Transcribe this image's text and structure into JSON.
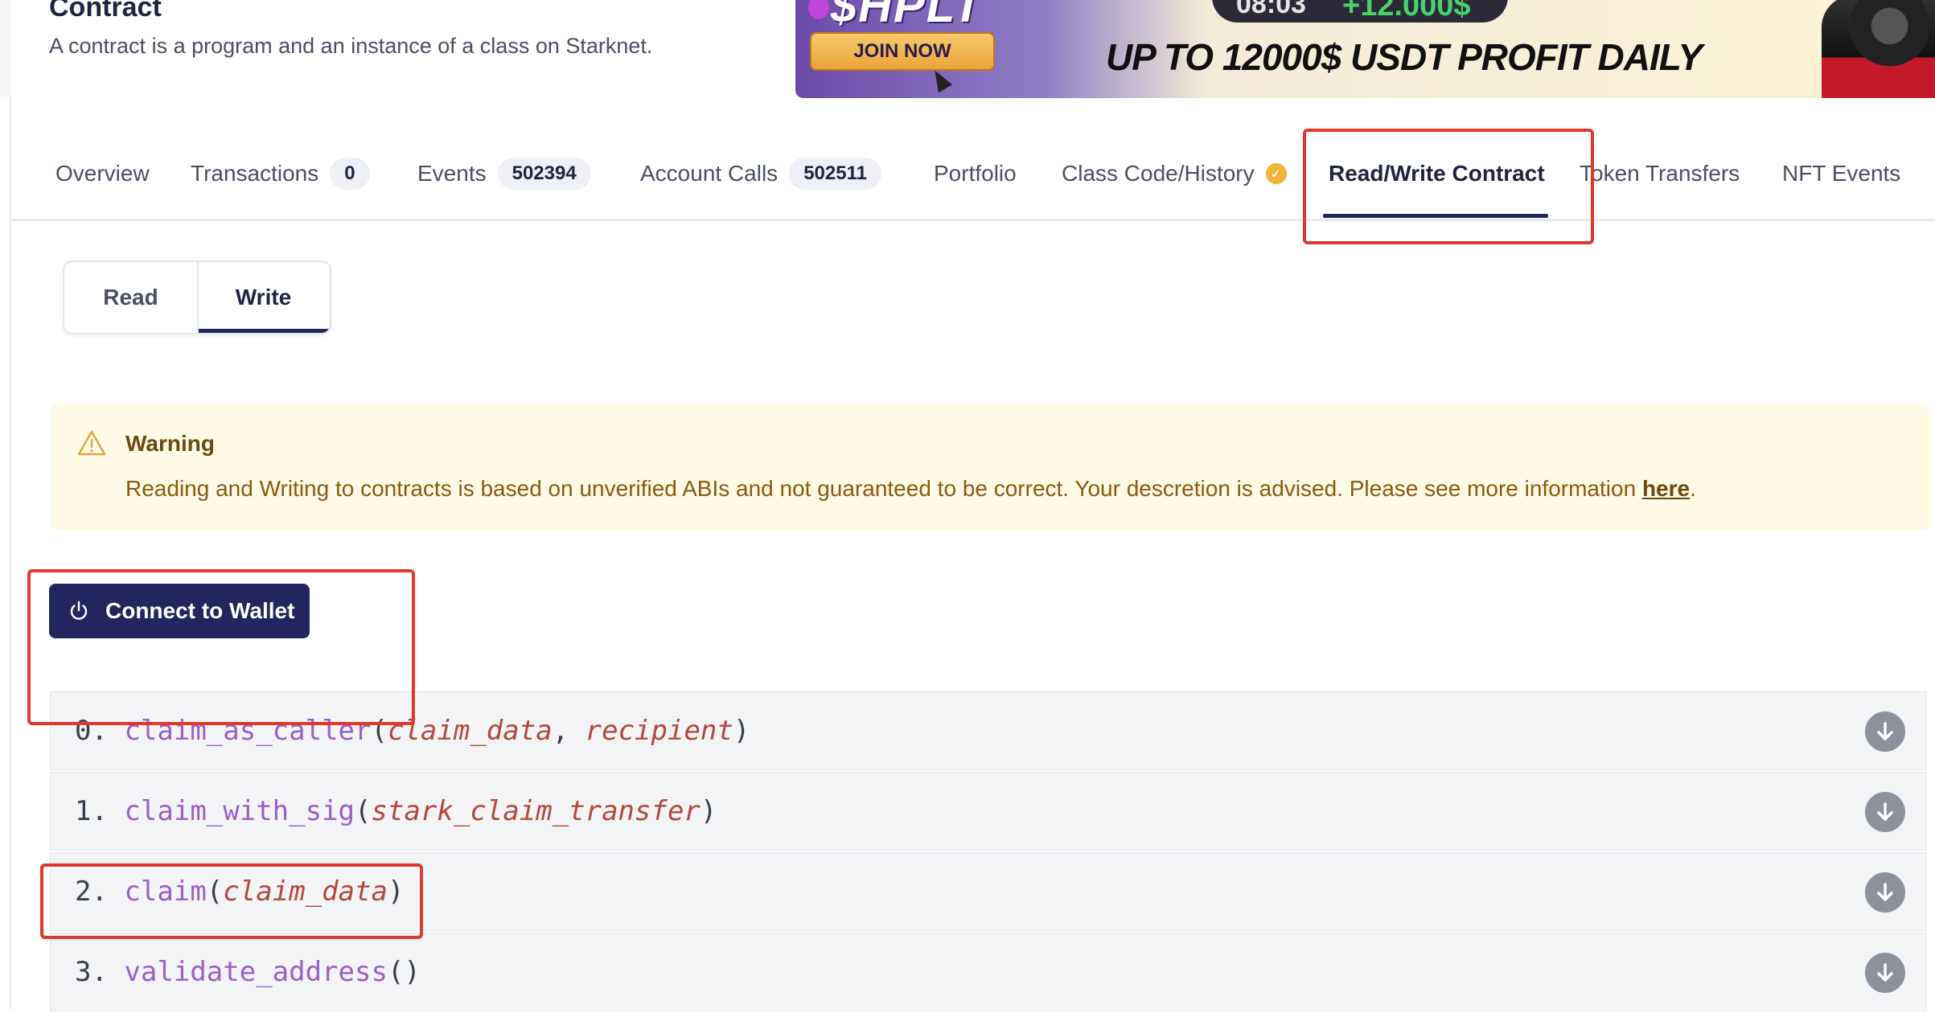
{
  "header": {
    "title": "Contract",
    "subtitle": "A contract is a program and an instance of a class on Starknet."
  },
  "banner": {
    "brand": "$HPLT",
    "join_label": "JOIN NOW",
    "pill_left": "08:03",
    "pill_right": "+12.000$",
    "headline": "UP TO 12000$ USDT PROFIT DAILY"
  },
  "tabs": [
    {
      "label": "Overview"
    },
    {
      "label": "Transactions",
      "count": "0"
    },
    {
      "label": "Events",
      "count": "502394"
    },
    {
      "label": "Account Calls",
      "count": "502511"
    },
    {
      "label": "Portfolio"
    },
    {
      "label": "Class Code/History"
    },
    {
      "label": "Read/Write Contract",
      "active": true
    },
    {
      "label": "Token Transfers"
    },
    {
      "label": "NFT Events"
    }
  ],
  "mode_toggle": {
    "read": "Read",
    "write": "Write",
    "selected": "Write"
  },
  "warning": {
    "title": "Warning",
    "text": "Reading and Writing to contracts is based on unverified ABIs and not guaranteed to be correct. Your descretion is advised. Please see more information ",
    "link": "here",
    "end": "."
  },
  "connect_button": {
    "label": "Connect to Wallet"
  },
  "functions": [
    {
      "index": "0.",
      "name": "claim_as_caller",
      "params": [
        "claim_data",
        "recipient"
      ]
    },
    {
      "index": "1.",
      "name": "claim_with_sig",
      "params": [
        "stark_claim_transfer"
      ]
    },
    {
      "index": "2.",
      "name": "claim",
      "params": [
        "claim_data"
      ]
    },
    {
      "index": "3.",
      "name": "validate_address",
      "params": []
    }
  ],
  "colors": {
    "accent": "#23265e",
    "warning_bg": "#fffbe6",
    "highlight": "#e0392b",
    "function_name": "#9a5fc9",
    "param": "#b5473d"
  }
}
